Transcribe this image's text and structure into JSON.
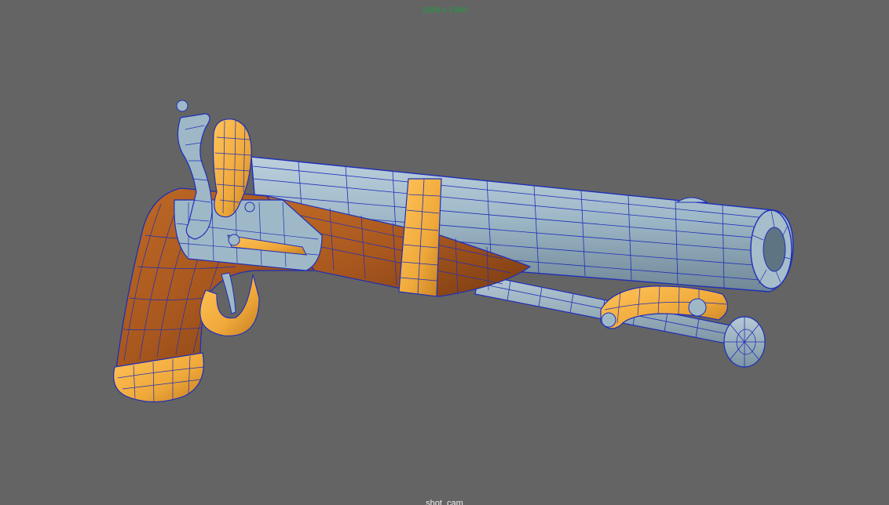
{
  "viewport": {
    "background": "#646464",
    "resolution_gate": "1500 x 1500",
    "camera_name": "shot_cam"
  },
  "model": {
    "subject": "flintlock-pistol",
    "display_mode": "wireframe-on-shaded",
    "wire_color": "#1e2fb8",
    "materials": {
      "metal": "#9fb8c8",
      "wood": "#a8571e",
      "brass": "#f0a93a"
    }
  }
}
